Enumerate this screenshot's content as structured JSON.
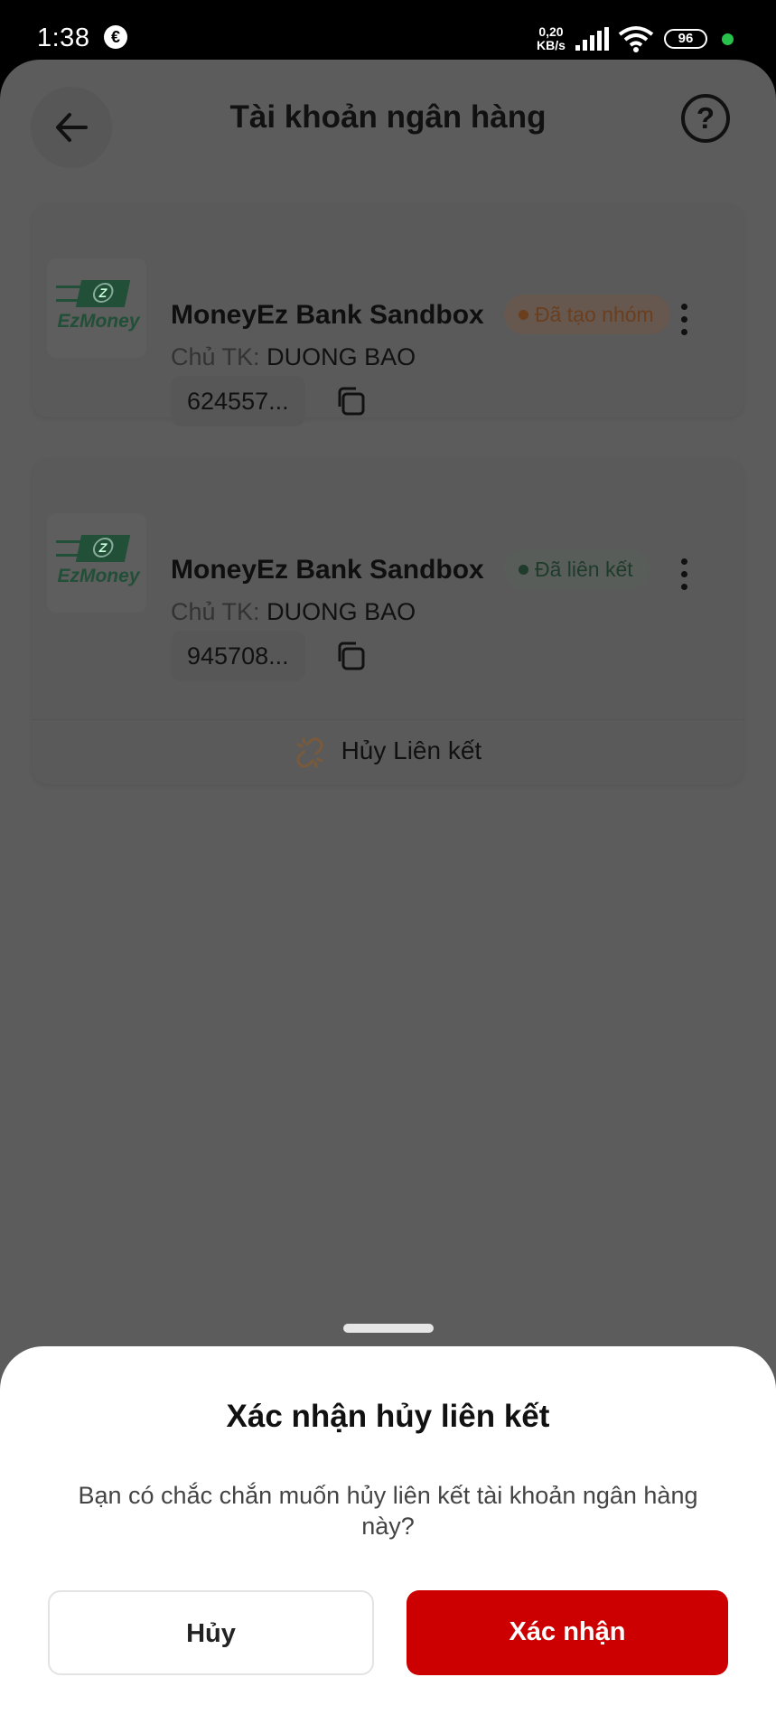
{
  "status_bar": {
    "time": "1:38",
    "net_speed_value": "0,20",
    "net_speed_unit": "KB/s",
    "battery": "96"
  },
  "header": {
    "title": "Tài khoản ngân hàng",
    "help_glyph": "?"
  },
  "accounts": [
    {
      "logo_text": "EzMoney",
      "bank_name": "MoneyEz Bank Sandbox",
      "badge": "Đã tạo nhóm",
      "owner_label": "Chủ TK:",
      "owner_name": "DUONG BAO",
      "account_number": "624557..."
    },
    {
      "logo_text": "EzMoney",
      "bank_name": "MoneyEz Bank Sandbox",
      "badge": "Đã liên kết",
      "owner_label": "Chủ TK:",
      "owner_name": "DUONG BAO",
      "account_number": "945708...",
      "action_label": "Hủy Liên kết"
    }
  ],
  "dialog": {
    "title": "Xác nhận hủy liên kết",
    "message": "Bạn có chắc chắn muốn hủy liên kết tài khoản ngân hàng này?",
    "cancel_label": "Hủy",
    "confirm_label": "Xác nhận"
  },
  "colors": {
    "confirm": "#cc0000",
    "badge_orange": "#e8772e",
    "badge_green": "#2f7a4f",
    "overlay": "#5c5c5c"
  }
}
